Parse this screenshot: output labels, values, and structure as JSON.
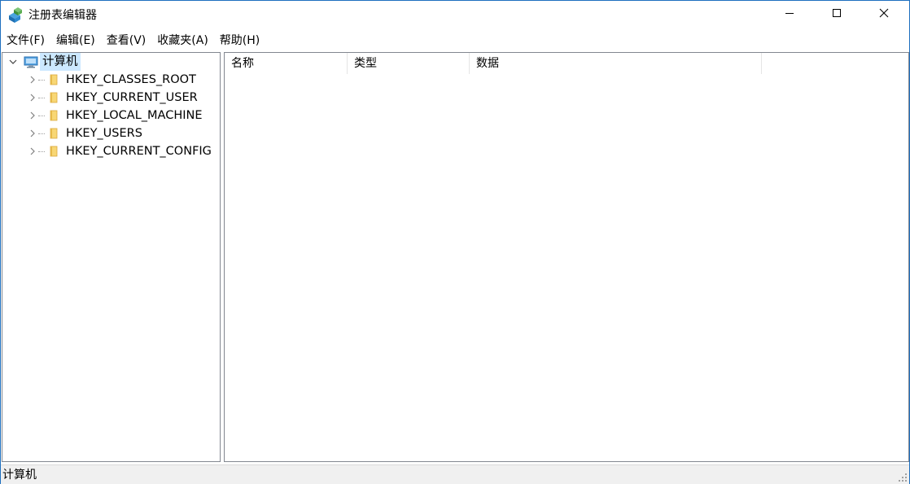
{
  "window": {
    "title": "注册表编辑器",
    "accent_color": "#1e6fbf"
  },
  "titlebar_buttons": {
    "minimize_icon": "minimize-icon",
    "maximize_icon": "maximize-icon",
    "close_icon": "close-icon"
  },
  "menu": {
    "items": [
      {
        "label": "文件(F)"
      },
      {
        "label": "编辑(E)"
      },
      {
        "label": "查看(V)"
      },
      {
        "label": "收藏夹(A)"
      },
      {
        "label": "帮助(H)"
      }
    ]
  },
  "tree": {
    "root": {
      "label": "计算机",
      "icon": "computer-icon",
      "expanded": true,
      "selected": true
    },
    "children": [
      {
        "label": "HKEY_CLASSES_ROOT",
        "icon": "folder-icon"
      },
      {
        "label": "HKEY_CURRENT_USER",
        "icon": "folder-icon"
      },
      {
        "label": "HKEY_LOCAL_MACHINE",
        "icon": "folder-icon"
      },
      {
        "label": "HKEY_USERS",
        "icon": "folder-icon"
      },
      {
        "label": "HKEY_CURRENT_CONFIG",
        "icon": "folder-icon"
      }
    ]
  },
  "list": {
    "columns": [
      {
        "label": "名称"
      },
      {
        "label": "类型"
      },
      {
        "label": "数据"
      }
    ]
  },
  "status": {
    "path": "计算机"
  },
  "colors": {
    "selection_bg": "#cce8ff",
    "folder_yellow": "#f8d775",
    "pane_border": "#828790",
    "statusbar_bg": "#f0f0f0"
  }
}
